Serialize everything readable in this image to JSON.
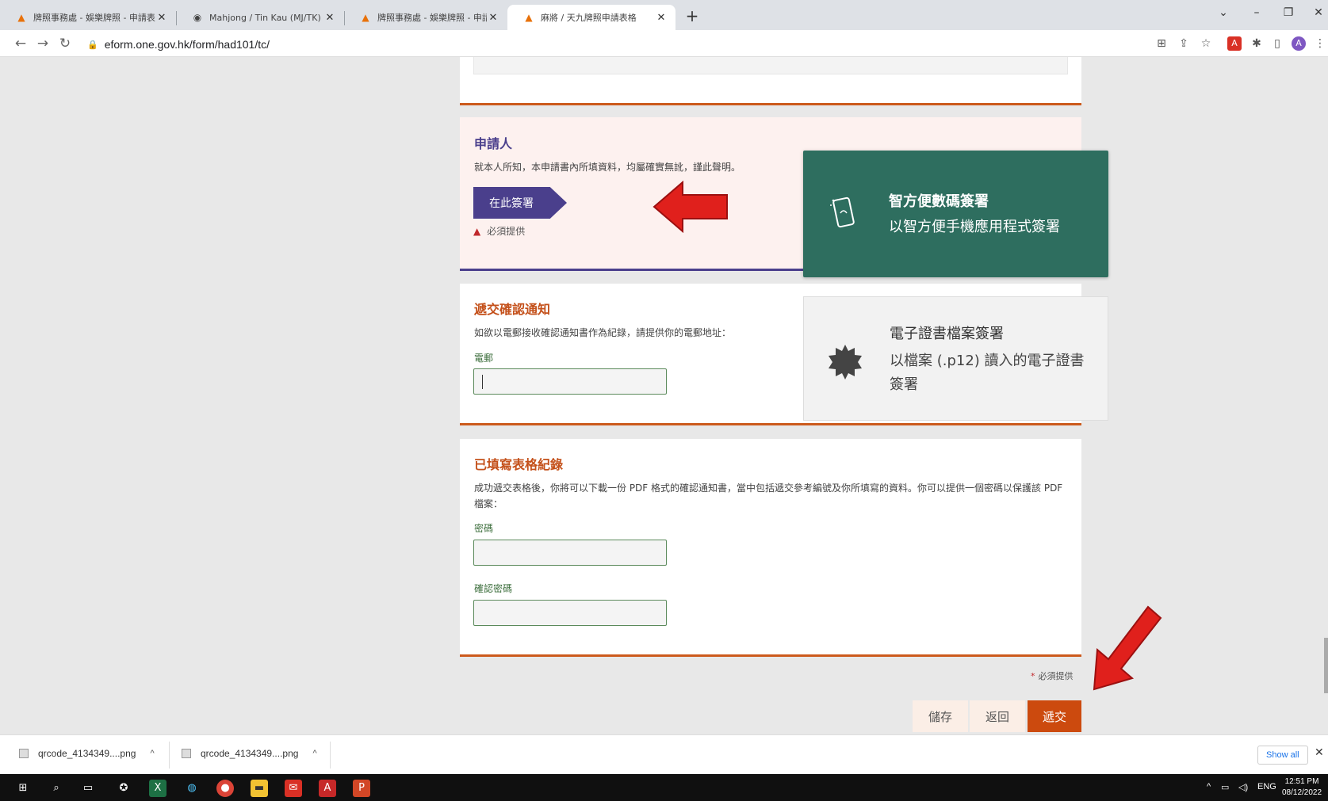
{
  "browser": {
    "tabs": [
      {
        "label": "牌照事務處 - 娛樂牌照 - 申請表格",
        "icon": "hk-gov-icon"
      },
      {
        "label": "Mahjong / Tin Kau (MJ/TK) Lice",
        "icon": "globe-icon"
      },
      {
        "label": "牌照事務處 - 娛樂牌照 - 申請表格",
        "icon": "hk-gov-icon"
      },
      {
        "label": "麻將 / 天九牌照申請表格",
        "icon": "hk-gov-icon"
      }
    ],
    "url": "eform.one.gov.hk/form/had101/tc/"
  },
  "applicant": {
    "title": "申請人",
    "declaration": "就本人所知，本申請書內所填資料，均屬確實無訛，謹此聲明。",
    "sign_button": "在此簽署",
    "required_text": "必須提供"
  },
  "sign_popup": {
    "option1_title": "智方便數碼簽署",
    "option1_sub": "以智方便手機應用程式簽署",
    "option2_title": "電子證書檔案簽署",
    "option2_sub": "以檔案 (.p12) 讀入的電子證書簽署"
  },
  "confirmation": {
    "title": "遞交確認通知",
    "text": "如欲以電郵接收確認通知書作為紀錄，請提供你的電郵地址：",
    "email_label": "電郵",
    "email_value": ""
  },
  "record": {
    "title": "已填寫表格紀錄",
    "text": "成功遞交表格後，你將可以下載一份 PDF 格式的確認通知書，當中包括遞交參考編號及你所填寫的資料。你可以提供一個密碼以保護該 PDF 檔案：",
    "password_label": "密碼",
    "confirm_password_label": "確認密碼"
  },
  "footer": {
    "required_note": "必須提供",
    "save": "儲存",
    "back": "返回",
    "submit": "遞交"
  },
  "downloads": {
    "items": [
      "qrcode_4134349....png",
      "qrcode_4134349....png"
    ],
    "show_all": "Show all"
  },
  "taskbar": {
    "lang": "ENG",
    "time": "12:51 PM",
    "date": "08/12/2022"
  },
  "colors": {
    "purple": "#4a3f8c",
    "orange": "#cc4a0e",
    "green_popup": "#2e6e5f"
  }
}
